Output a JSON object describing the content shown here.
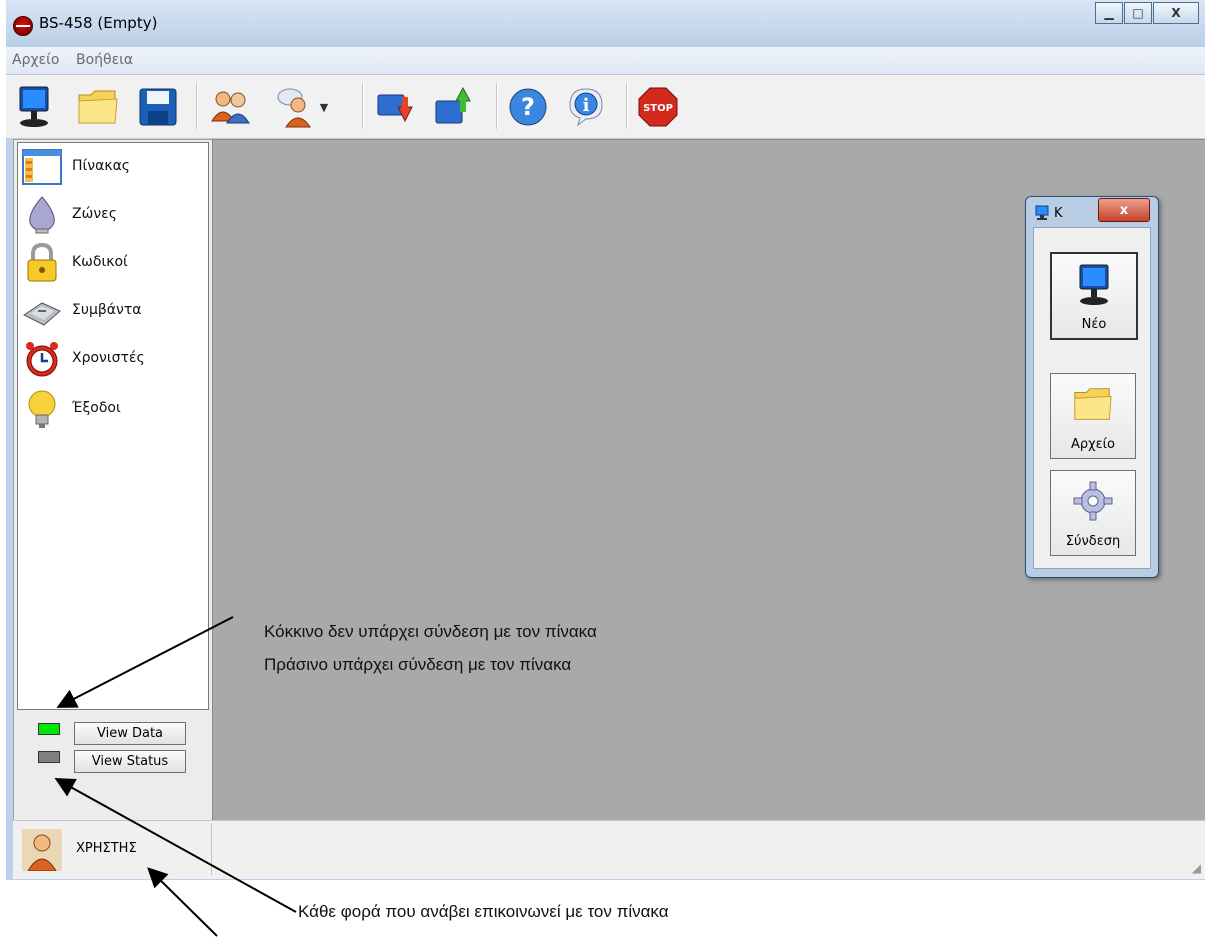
{
  "window": {
    "title": "BS-458 (Empty)"
  },
  "menu": {
    "items": [
      "Αρχείο",
      "Βοήθεια"
    ]
  },
  "toolbar": {
    "stop_label": "STOP"
  },
  "nav": {
    "items": [
      {
        "label": "Πίνακας",
        "icon": "panel-icon"
      },
      {
        "label": "Ζώνες",
        "icon": "zones-icon"
      },
      {
        "label": "Κωδικοί",
        "icon": "lock-icon"
      },
      {
        "label": "Συμβάντα",
        "icon": "events-icon"
      },
      {
        "label": "Χρονιστές",
        "icon": "alarm-clock-icon"
      },
      {
        "label": "Έξοδοι",
        "icon": "lightbulb-icon"
      }
    ]
  },
  "buttons": {
    "view_data": "View Data",
    "view_status": "View Status"
  },
  "leds": {
    "connection_color": "#00e600",
    "status_color": "#808080"
  },
  "status": {
    "user": "ΧΡΗΣΤΗΣ"
  },
  "child_window": {
    "title": "Κ",
    "close": "x",
    "new_label": "Νέο",
    "file_label": "Αρχείο",
    "connect_label": "Σύνδεση"
  },
  "annotations": {
    "red_line": "Κόκκινο δεν υπάρχει σύνδεση με τον πίνακα",
    "green_line": "Πράσινο υπάρχει σύνδεση με τον πίνακα",
    "status_line": "Κάθε φορά που ανάβει επικοινωνεί με τον πίνακα"
  }
}
